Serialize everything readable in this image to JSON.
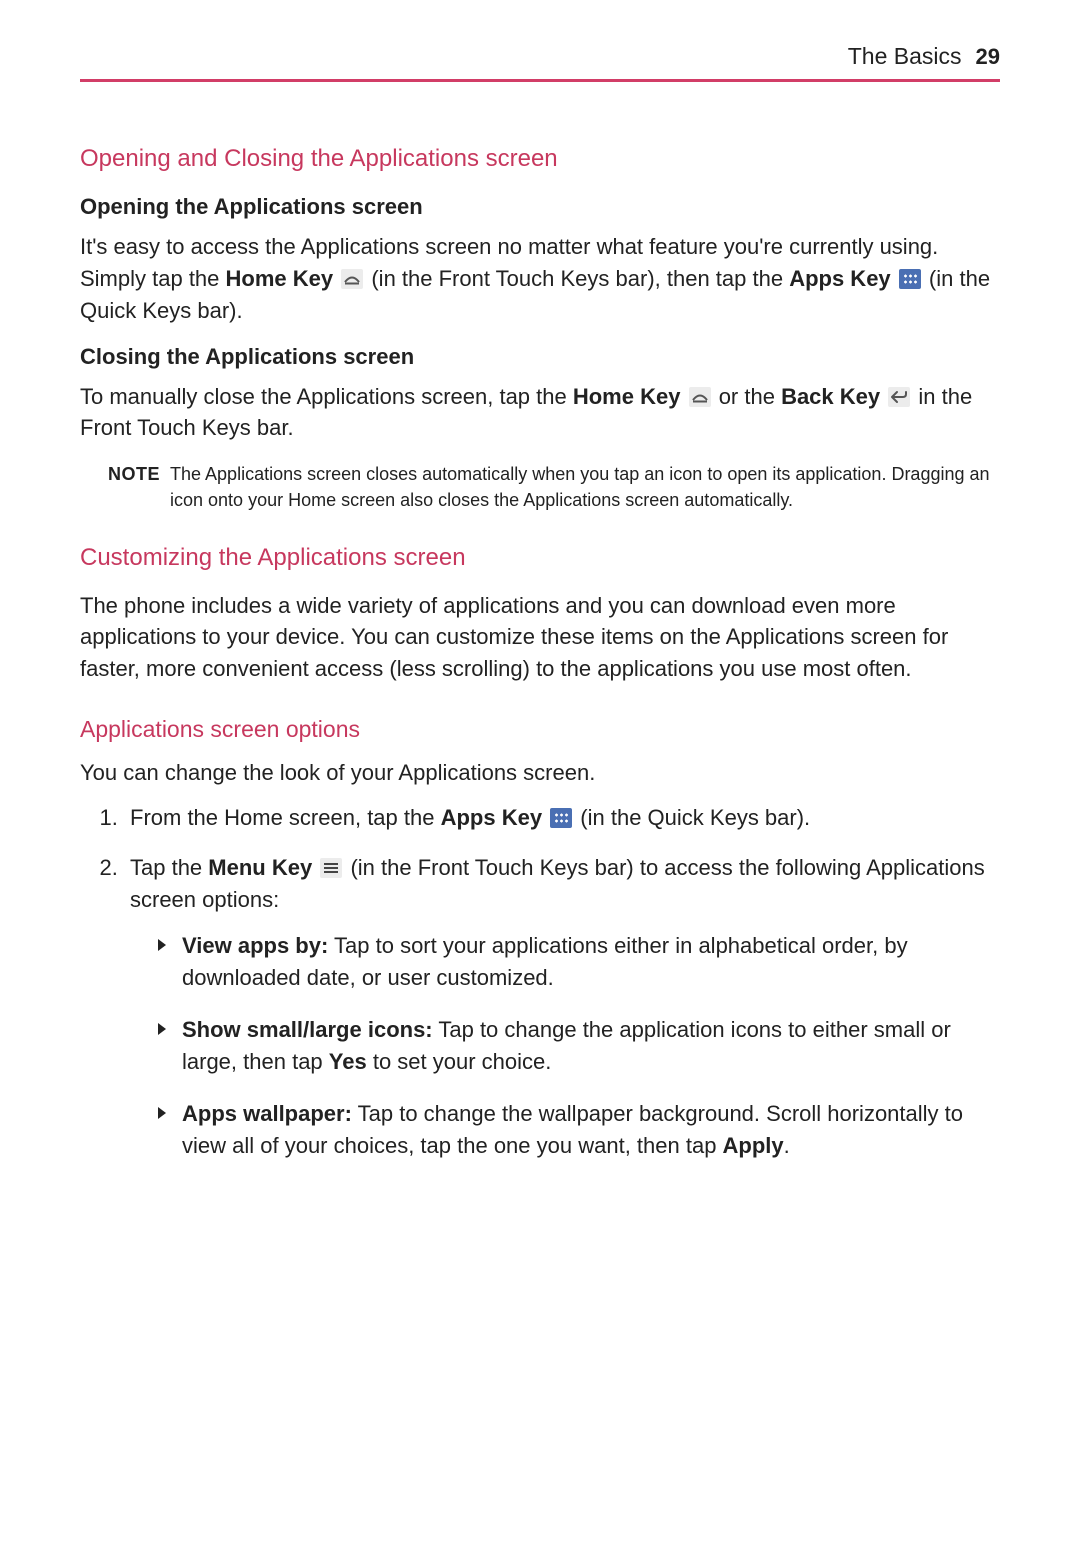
{
  "header": {
    "section": "The Basics",
    "page": "29"
  },
  "s1": {
    "title": "Opening and Closing the Applications screen",
    "open": {
      "sub": "Opening the Applications screen",
      "p1a": "It's easy to access the Applications screen no matter what feature you're currently using. Simply tap the ",
      "p1b": "Home Key",
      "p1c": " (in the Front Touch Keys bar), then tap the ",
      "p1d": "Apps Key",
      "p1e": " (in the Quick Keys bar)."
    },
    "close": {
      "sub": "Closing the Applications screen",
      "p1a": "To manually close the Applications screen, tap the ",
      "p1b": "Home Key",
      "p1c": " or the ",
      "p1d": "Back Key",
      "p1e": " in the Front Touch Keys bar."
    },
    "note": {
      "label": "NOTE",
      "text": "The Applications screen closes automatically when you tap an icon to open its application. Dragging an icon onto your Home screen also closes the Applications screen automatically."
    }
  },
  "s2": {
    "title": "Customizing the Applications screen",
    "p": "The phone includes a wide variety of applications and you can download even more applications to your device. You can customize these items on the Applications screen for faster, more convenient access (less scrolling) to the applications you use most often."
  },
  "s3": {
    "title": "Applications screen options",
    "intro": "You can change the look of your Applications screen.",
    "step1": {
      "a": "From the Home screen, tap the ",
      "b": "Apps Key",
      "c": " (in the Quick Keys bar)."
    },
    "step2": {
      "a": "Tap the ",
      "b": "Menu Key",
      "c": " (in the Front Touch Keys bar) to access the following Applications screen options:"
    },
    "b1": {
      "t": "View apps by:",
      "r": " Tap to sort your applications either in alphabetical order, by downloaded date, or user customized."
    },
    "b2": {
      "t": "Show small/large icons:",
      "r1": " Tap to change the application icons to either small or large, then tap ",
      "r2": "Yes",
      "r3": " to set your choice."
    },
    "b3": {
      "t": "Apps wallpaper:",
      "r1": " Tap to change the wallpaper background. Scroll horizontally to view all of your choices, tap the one you want, then tap ",
      "r2": "Apply",
      "r3": "."
    }
  }
}
